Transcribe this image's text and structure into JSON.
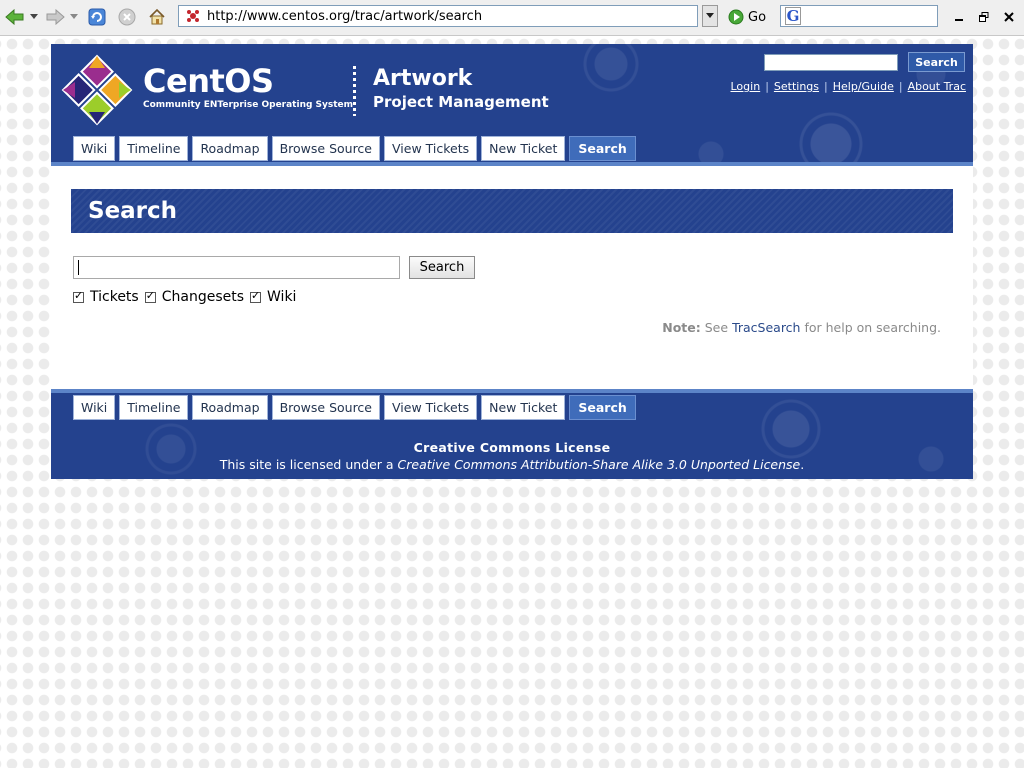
{
  "browser": {
    "url": "http://www.centos.org/trac/artwork/search",
    "go_label": "Go"
  },
  "header": {
    "brand_name": "CentOS",
    "brand_tagline": "Community ENTerprise Operating System",
    "project_title": "Artwork",
    "project_subtitle": "Project Management",
    "search_button": "Search",
    "meta_nav": [
      "Login",
      "Settings",
      "Help/Guide",
      "About Trac"
    ]
  },
  "tabs": [
    {
      "label": "Wiki",
      "active": false
    },
    {
      "label": "Timeline",
      "active": false
    },
    {
      "label": "Roadmap",
      "active": false
    },
    {
      "label": "Browse Source",
      "active": false
    },
    {
      "label": "View Tickets",
      "active": false
    },
    {
      "label": "New Ticket",
      "active": false
    },
    {
      "label": "Search",
      "active": true
    }
  ],
  "main": {
    "heading": "Search",
    "query_value": "",
    "search_button": "Search",
    "filters": [
      {
        "label": "Tickets",
        "checked": true
      },
      {
        "label": "Changesets",
        "checked": true
      },
      {
        "label": "Wiki",
        "checked": true
      }
    ],
    "note": {
      "prefix": "Note:",
      "before": "See",
      "link": "TracSearch",
      "after": "for help on searching."
    }
  },
  "footer": {
    "license_title": "Creative Commons License",
    "license_prefix": "This site is licensed under a",
    "license_link": "Creative Commons Attribution-Share Alike 3.0 Unported License",
    "license_suffix": "."
  },
  "colors": {
    "banner_blue": "#24428e",
    "active_tab": "#3f6cba",
    "link": "#2a4a8a"
  }
}
